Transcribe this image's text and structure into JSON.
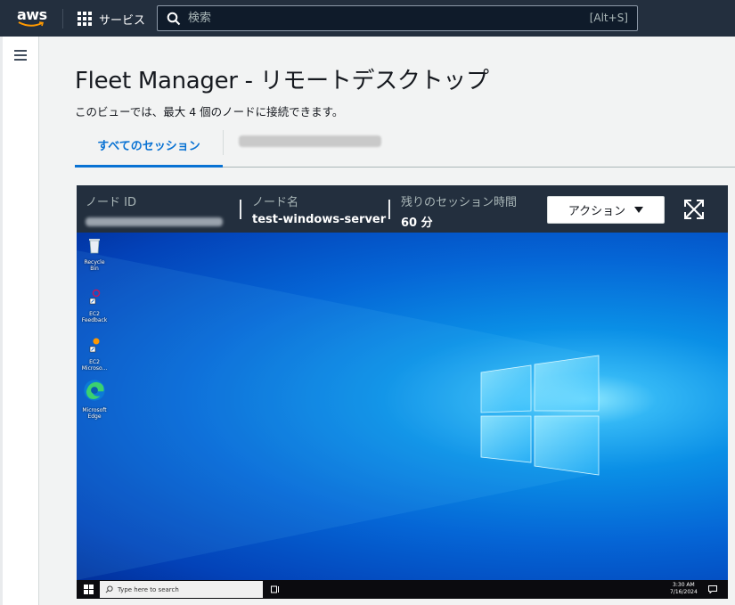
{
  "topnav": {
    "logo": "aws",
    "services_label": "サービス",
    "search_placeholder": "検索",
    "search_shortcut": "[Alt+S]"
  },
  "page": {
    "title": "Fleet Manager - リモートデスクトップ",
    "subtitle": "このビューでは、最大 4 個のノードに接続できます。"
  },
  "tabs": {
    "active_label": "すべてのセッション"
  },
  "session": {
    "node_id_label": "ノード ID",
    "node_name_label": "ノード名",
    "node_name_value": "test-windows-server",
    "time_label": "残りのセッション時間",
    "time_value": "60 分",
    "action_label": "アクション"
  },
  "desktop": {
    "icons": [
      {
        "label": "Recycle Bin",
        "icon": "recycle-bin-icon"
      },
      {
        "label": "EC2\nFeedback",
        "icon": "ec2-feedback-icon"
      },
      {
        "label": "EC2\nMicroso...",
        "icon": "ec2-microsoft-icon"
      },
      {
        "label": "Microsoft\nEdge",
        "icon": "edge-icon"
      }
    ],
    "taskbar": {
      "search_placeholder": "Type here to search",
      "time": "3:30 AM",
      "date": "7/16/2024"
    }
  },
  "colors": {
    "nav_bg": "#232f3e",
    "accent": "#0972d3",
    "desktop_blue": "#0a8fe6"
  }
}
